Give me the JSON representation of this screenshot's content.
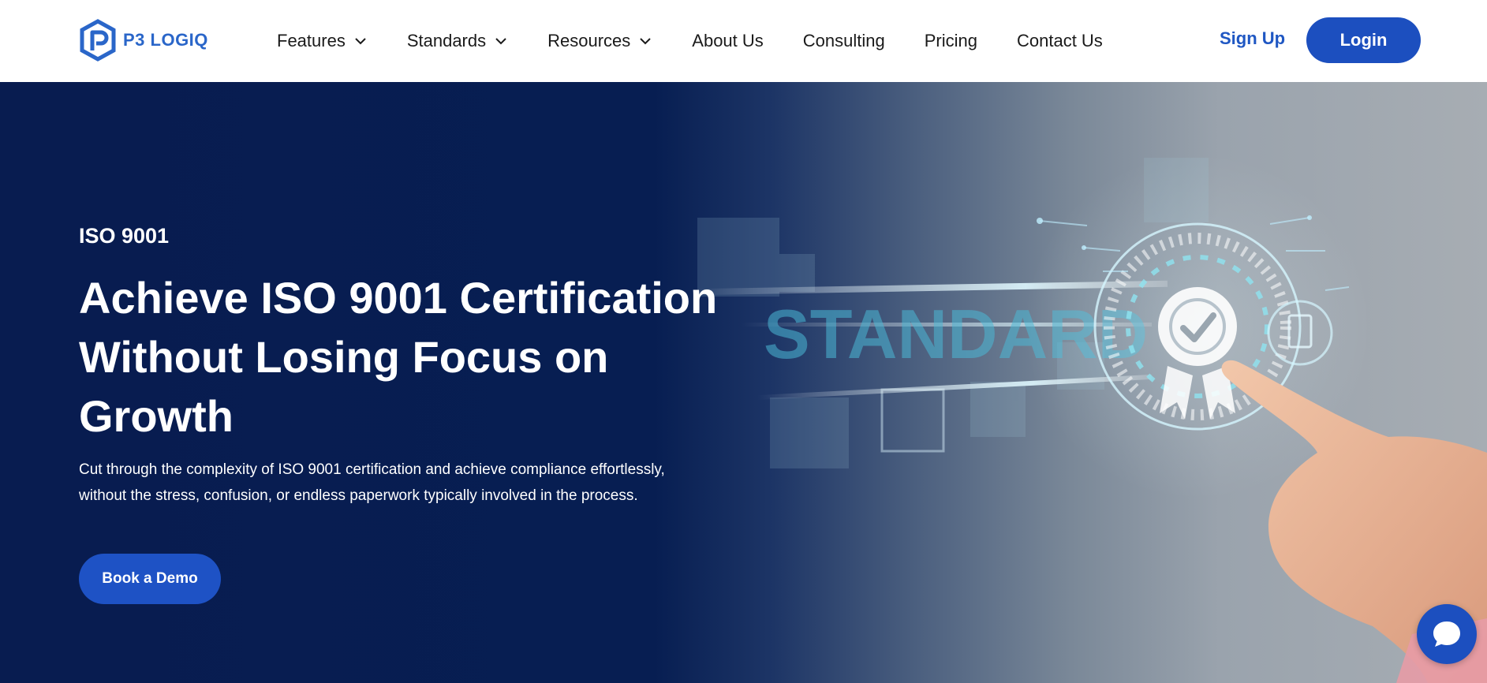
{
  "brand": {
    "name": "P3 LOGIQ",
    "color": "#2a66c9"
  },
  "nav": {
    "items": [
      {
        "label": "Features",
        "dropdown": true
      },
      {
        "label": "Standards",
        "dropdown": true
      },
      {
        "label": "Resources",
        "dropdown": true
      },
      {
        "label": "About Us",
        "dropdown": false
      },
      {
        "label": "Consulting",
        "dropdown": false
      },
      {
        "label": "Pricing",
        "dropdown": false
      },
      {
        "label": "Contact Us",
        "dropdown": false
      }
    ],
    "signup_label": "Sign Up",
    "login_label": "Login"
  },
  "hero": {
    "eyebrow": "ISO 9001",
    "headline": "Achieve ISO 9001 Certification Without Losing Focus on Growth",
    "subtext": "Cut through the complexity of ISO 9001 certification and achieve compliance effortlessly, without the stress, confusion, or endless paperwork typically involved in the process.",
    "cta_label": "Book a Demo",
    "image_text": "STANDARD"
  },
  "colors": {
    "primary": "#1c4fbf",
    "hero_bg": "#071e52",
    "accent_glow": "#8fe3f0"
  },
  "icons": {
    "logo": "hexagon-p-logo-icon",
    "dropdown": "chevron-down-icon",
    "chat": "chat-bubble-icon"
  }
}
